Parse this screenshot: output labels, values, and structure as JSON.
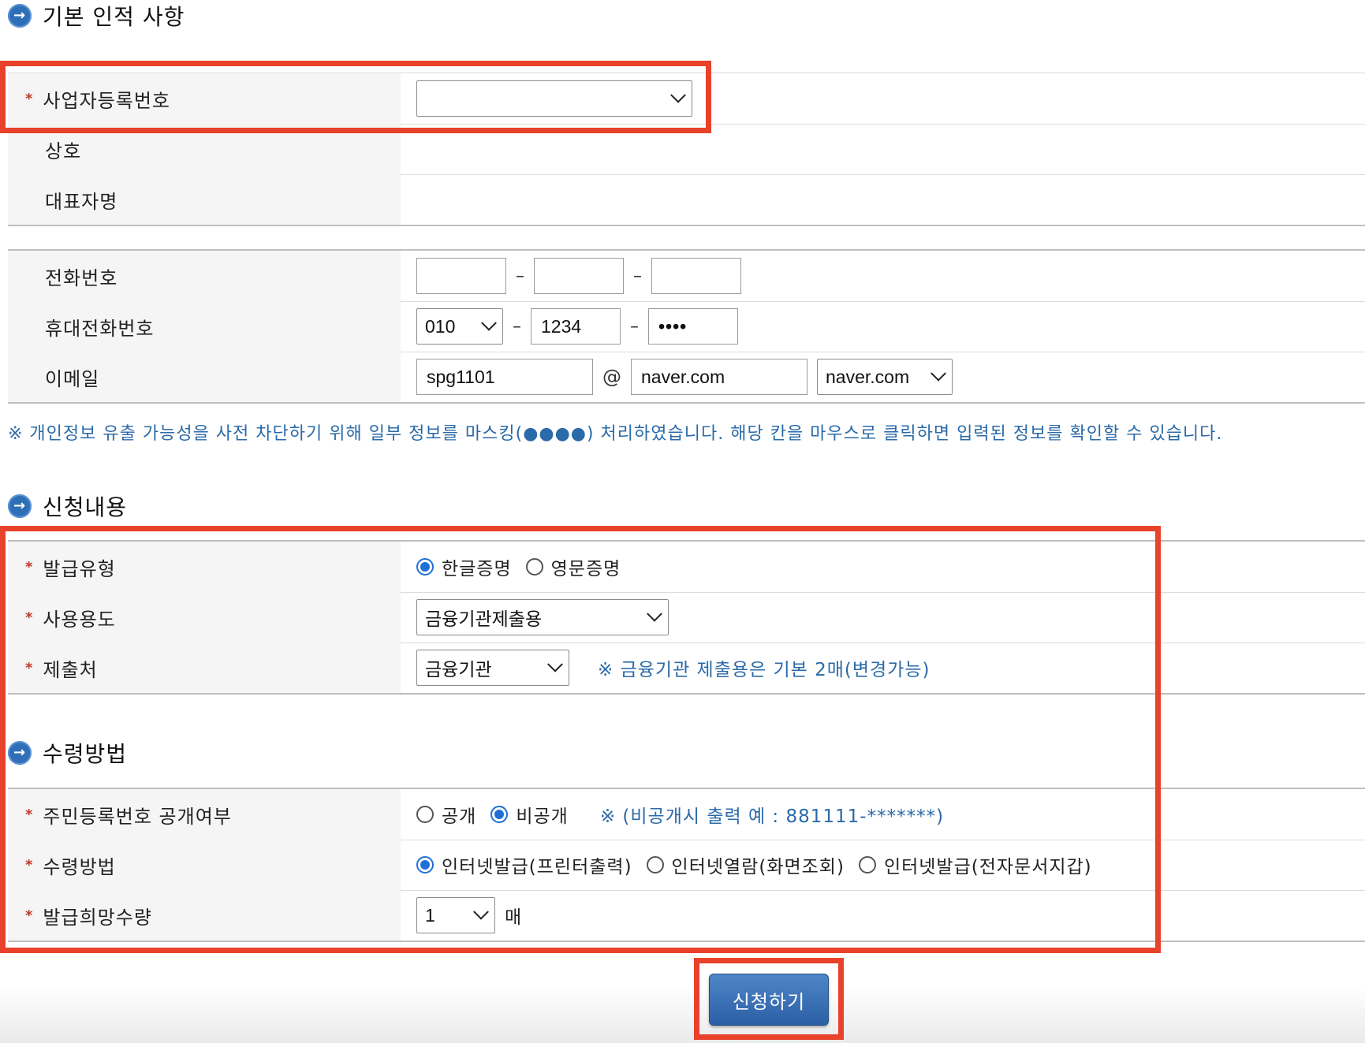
{
  "section_basic": {
    "title": "기본 인적 사항"
  },
  "basic": {
    "biz_no_label": "사업자등록번호",
    "biz_no_value": "",
    "company_label": "상호",
    "rep_label": "대표자명",
    "phone_label": "전화번호",
    "phone": [
      "",
      "",
      ""
    ],
    "mobile_label": "휴대전화번호",
    "mobile": [
      "010",
      "1234",
      "••••"
    ],
    "email_label": "이메일",
    "email_id": "spg1101",
    "email_at": "@",
    "email_domain": "naver.com",
    "email_domain_select": "naver.com",
    "dash": "–"
  },
  "privacy_note": "※ 개인정보 유출 가능성을 사전 차단하기 위해 일부 정보를 마스킹(●●●●) 처리하였습니다. 해당 칸을 마우스로 클릭하면 입력된 정보를 확인할 수 있습니다.",
  "section_apply": {
    "title": "신청내용"
  },
  "apply": {
    "type_label": "발급유형",
    "type_options": [
      "한글증명",
      "영문증명"
    ],
    "type_selected": 0,
    "purpose_label": "사용용도",
    "purpose_value": "금융기관제출용",
    "dest_label": "제출처",
    "dest_value": "금융기관",
    "dest_note": "※ 금융기관 제출용은 기본 2매(변경가능)"
  },
  "section_receive": {
    "title": "수령방법"
  },
  "receive": {
    "rrn_label": "주민등록번호 공개여부",
    "rrn_options": [
      "공개",
      "비공개"
    ],
    "rrn_selected": 1,
    "rrn_note": "※ (비공개시 출력 예 : 881111-*******)",
    "method_label": "수령방법",
    "method_options": [
      "인터넷발급(프린터출력)",
      "인터넷열람(화면조회)",
      "인터넷발급(전자문서지갑)"
    ],
    "method_selected": 0,
    "qty_label": "발급희망수량",
    "qty_value": "1",
    "qty_unit": "매"
  },
  "required_mark": "*",
  "submit_label": "신청하기",
  "colors": {
    "highlight": "#e8412c",
    "accent": "#1f6fd6",
    "note": "#2b6aa8"
  }
}
